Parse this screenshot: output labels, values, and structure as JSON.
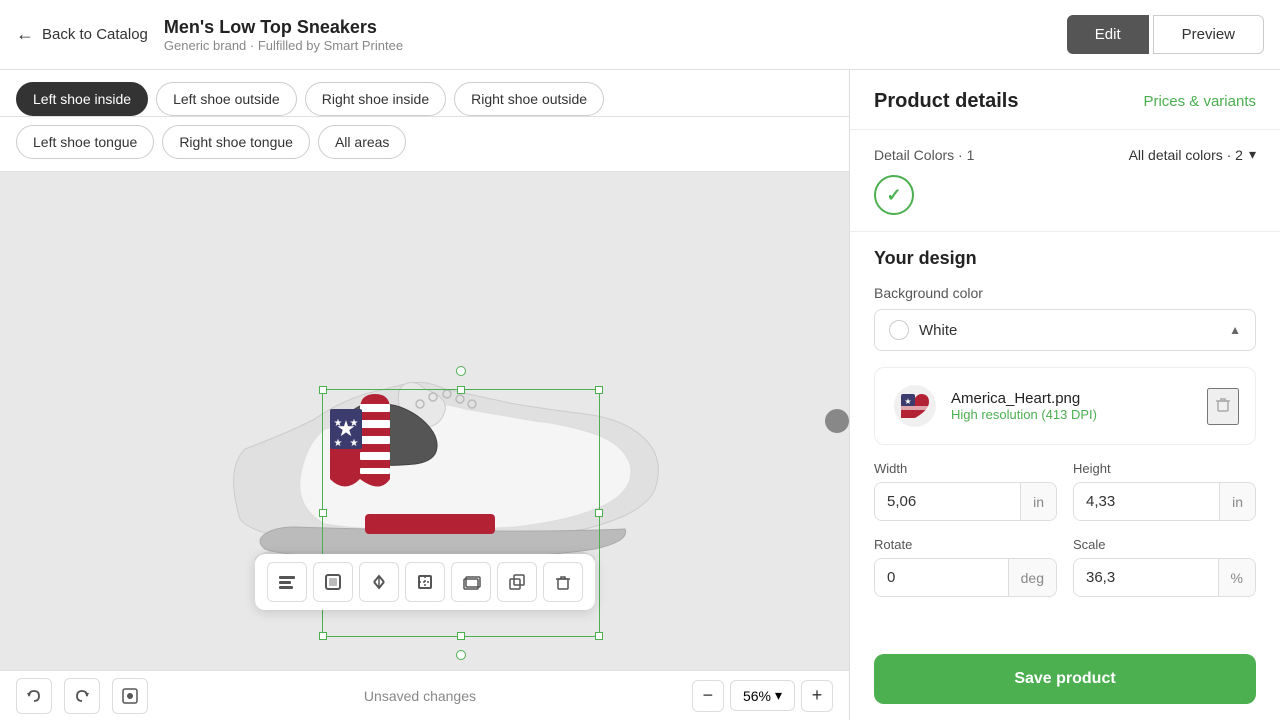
{
  "header": {
    "back_label": "Back to Catalog",
    "product_name": "Men's Low Top Sneakers",
    "product_subtitle": "Generic brand · Fulfilled by Smart Printee",
    "edit_label": "Edit",
    "preview_label": "Preview"
  },
  "tabs": {
    "row1": [
      {
        "label": "Left shoe inside",
        "active": true
      },
      {
        "label": "Left shoe outside",
        "active": false
      },
      {
        "label": "Right shoe inside",
        "active": false
      },
      {
        "label": "Right shoe outside",
        "active": false
      }
    ],
    "row2": [
      {
        "label": "Left shoe tongue",
        "active": false
      },
      {
        "label": "Right shoe tongue",
        "active": false
      },
      {
        "label": "All areas",
        "active": false
      }
    ]
  },
  "canvas": {
    "unsaved_label": "Unsaved changes",
    "zoom_value": "56%"
  },
  "panel": {
    "title": "Product details",
    "prices_link": "Prices & variants",
    "detail_colors_label": "Detail Colors · 1",
    "all_detail_colors_label": "All detail colors · 2",
    "design_title": "Your design",
    "bg_color_label": "Background color",
    "bg_color_value": "White",
    "design_filename": "America_Heart.png",
    "design_resolution": "High resolution (413 DPI)",
    "width_label": "Width",
    "width_value": "5,06",
    "width_unit": "in",
    "height_label": "Height",
    "height_value": "4,33",
    "height_unit": "in",
    "rotate_label": "Rotate",
    "rotate_value": "0",
    "rotate_unit": "deg",
    "scale_label": "Scale",
    "scale_value": "36,3",
    "scale_unit": "%",
    "save_label": "Save product"
  },
  "toolbar_tools": [
    {
      "icon": "⊞",
      "name": "align-tool"
    },
    {
      "icon": "⊟",
      "name": "fit-tool"
    },
    {
      "icon": "⇄",
      "name": "flip-tool"
    },
    {
      "icon": "⊡",
      "name": "crop-tool"
    },
    {
      "icon": "⧉",
      "name": "layer-tool"
    },
    {
      "icon": "❐",
      "name": "duplicate-tool"
    },
    {
      "icon": "🗑",
      "name": "delete-tool"
    }
  ]
}
